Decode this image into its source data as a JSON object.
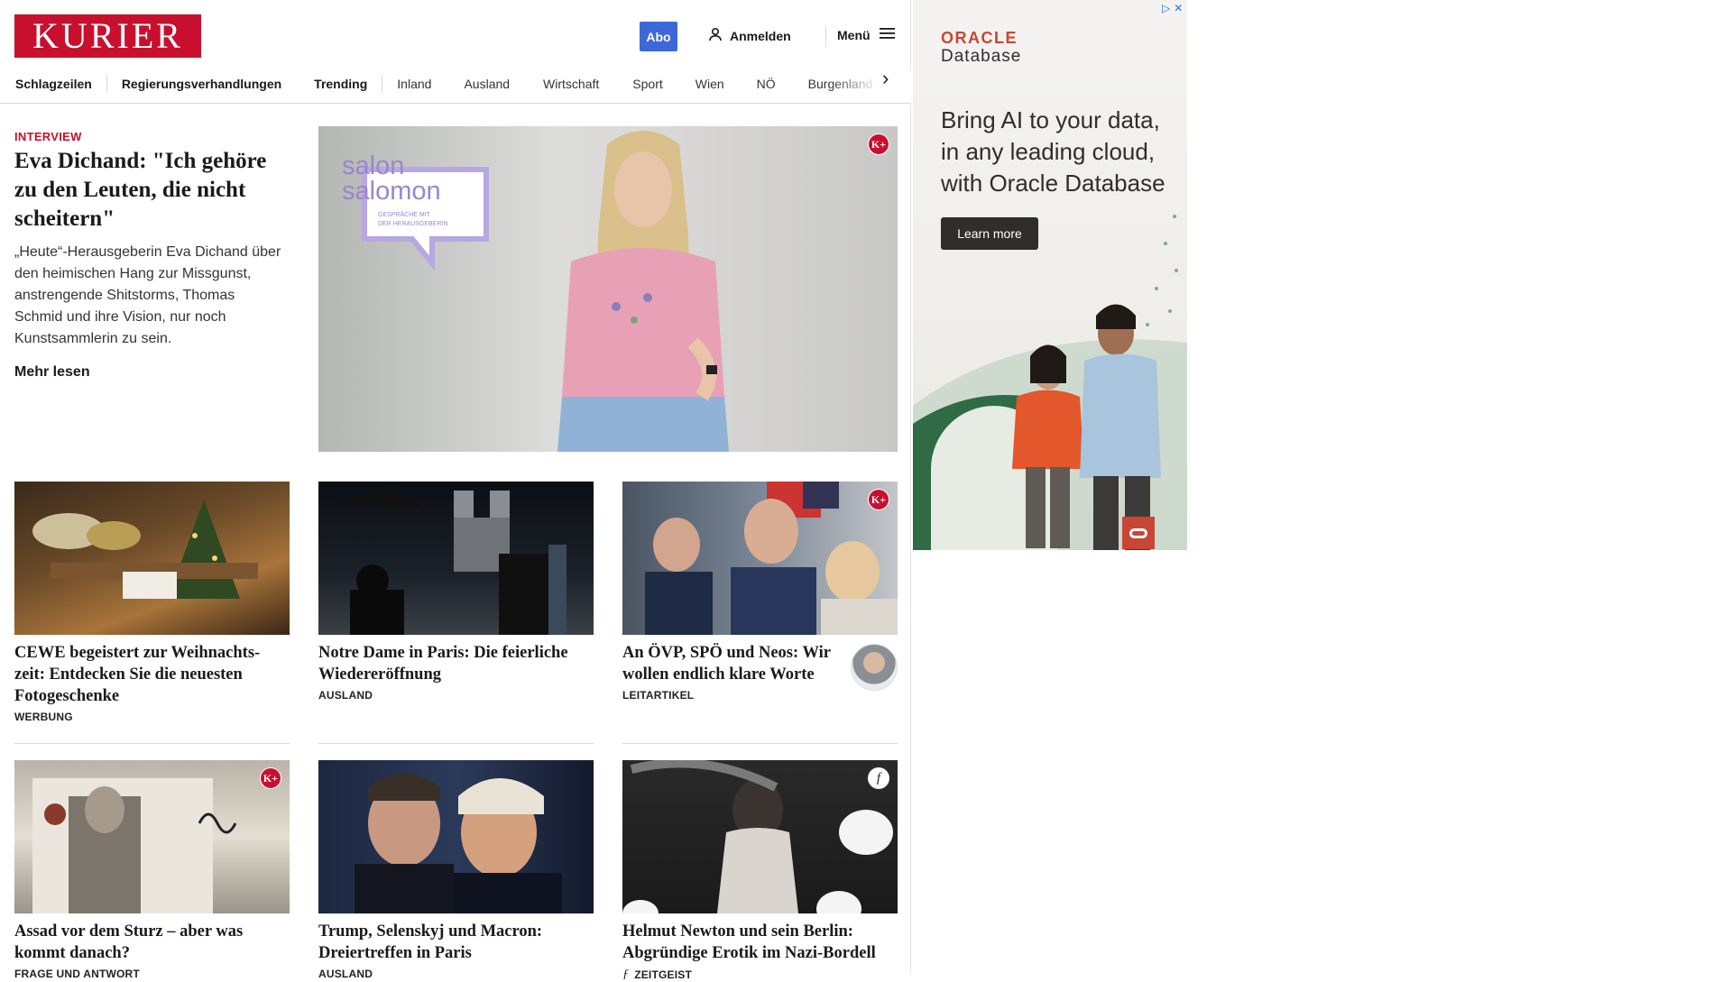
{
  "header": {
    "logo": "KURIER",
    "abo_label": "Abo",
    "login_label": "Anmelden",
    "menu_label": "Menü"
  },
  "nav": {
    "items": [
      {
        "label": "Schlagzeilen",
        "bold": true
      },
      {
        "label": "Regierungsverhandlungen",
        "bold": true
      },
      {
        "label": "Trending",
        "bold": true
      },
      {
        "label": "Inland",
        "bold": false
      },
      {
        "label": "Ausland",
        "bold": false
      },
      {
        "label": "Wirtschaft",
        "bold": false
      },
      {
        "label": "Sport",
        "bold": false
      },
      {
        "label": "Wien",
        "bold": false
      },
      {
        "label": "NÖ",
        "bold": false
      },
      {
        "label": "Burgenland",
        "bold": false
      }
    ]
  },
  "hero": {
    "kicker": "INTERVIEW",
    "title": "Eva Dichand: \"Ich gehöre zu den Leuten, die nicht scheitern\"",
    "teaser": "„Heute“-Herausgeberin Eva Dichand über den heimischen Hang zur Missgunst, anstrengende Shitstorms, Thomas Schmid und ihre Vision, nur noch Kunstsammlerin zu sein.",
    "more_label": "Mehr lesen",
    "overlay_line1": "salon",
    "overlay_line2": "salomon",
    "overlay_sub1": "GESPRÄCHE MIT",
    "overlay_sub2": "DER HERAUSGEBERIN",
    "badge": "K+"
  },
  "articles": [
    {
      "title": "CEWE begeistert zur Weihnachts-zeit: Entdecken Sie die neuesten Fotogeschenke",
      "category": "WERBUNG"
    },
    {
      "title": "Notre Dame in Paris: Die feierliche Wiedereröffnung",
      "category": "AUSLAND"
    },
    {
      "title": "An ÖVP, SPÖ und Neos: Wir wollen endlich klare Worte",
      "category": "LEITARTIKEL",
      "badge": "K+"
    },
    {
      "title": "Assad vor dem Sturz – aber was kommt danach?",
      "category": "FRAGE UND ANTWORT",
      "badge": "K+"
    },
    {
      "title": "Trump, Selenskyj und Macron: Dreiertreffen in Paris",
      "category": "AUSLAND"
    },
    {
      "title": "Helmut Newton und sein Berlin: Abgründige Erotik im Nazi-Bordell",
      "category": "ZEITGEIST",
      "badge": "f"
    }
  ],
  "ad": {
    "brand_line1": "ORACLE",
    "brand_line2": "Database",
    "headline": "Bring AI to your data, in any leading cloud, with Oracle Database",
    "cta": "Learn more",
    "colors": {
      "brand_red": "#c74634",
      "dark": "#312d2a"
    }
  },
  "colors": {
    "brand": "#c8102e",
    "abo": "#3d68d8"
  }
}
